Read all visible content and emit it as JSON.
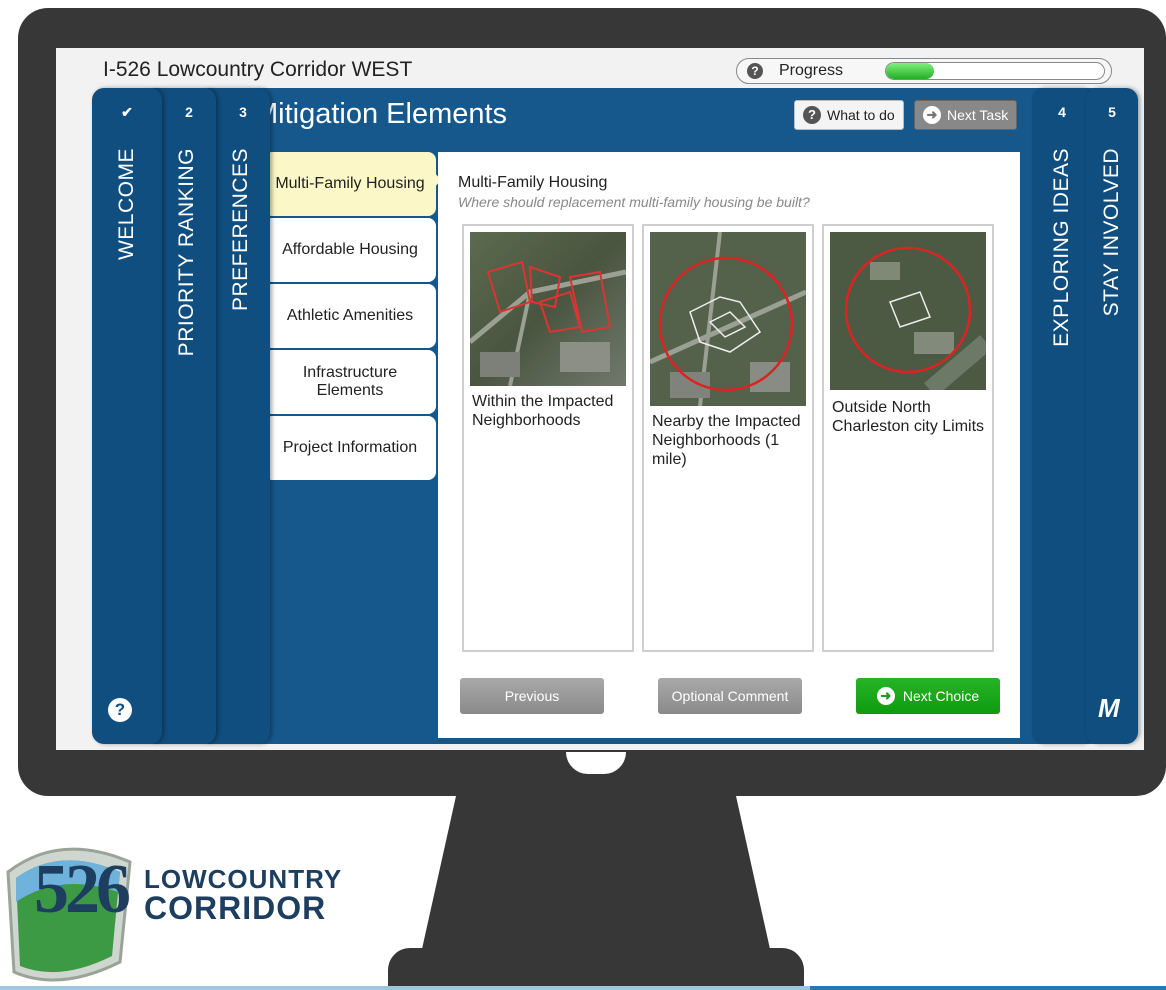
{
  "app": {
    "title": "I-526 Lowcountry Corridor WEST"
  },
  "progress": {
    "label": "Progress",
    "help_glyph": "?",
    "fraction": 0.22
  },
  "steps": [
    {
      "num": "✔",
      "label": "WELCOME"
    },
    {
      "num": "2",
      "label": "PRIORITY RANKING"
    },
    {
      "num": "3",
      "label": "PREFERENCES"
    },
    {
      "num": "4",
      "label": "EXPLORING IDEAS"
    },
    {
      "num": "5",
      "label": "STAY INVOLVED"
    }
  ],
  "help_glyph": "?",
  "header": {
    "title": "Mitigation Elements",
    "what_to_do": "What to do",
    "next_task": "Next Task",
    "help_glyph": "?",
    "arrow_glyph": "➜"
  },
  "choices": [
    {
      "label": "Multi-Family Housing",
      "active": true
    },
    {
      "label": "Affordable Housing"
    },
    {
      "label": "Athletic Amenities"
    },
    {
      "label": "Infrastructure Elements"
    },
    {
      "label": "Project Information"
    }
  ],
  "content": {
    "title": "Multi-Family Housing",
    "question": "Where should replacement multi-family housing be built?",
    "options": [
      {
        "label": "Within the Impacted Neighborhoods",
        "icon": "aerial-map-neighborhoods"
      },
      {
        "label": "Nearby the Impacted Neighborhoods (1 mile)",
        "icon": "aerial-map-1-mile-radius"
      },
      {
        "label": "Outside North Charleston city Limits",
        "icon": "aerial-map-outside-city"
      }
    ]
  },
  "footer": {
    "previous": "Previous",
    "optional_comment": "Optional Comment",
    "next_choice": "Next Choice",
    "arrow_glyph": "➜"
  },
  "brand": {
    "number": "526",
    "line1": "LOWCOUNTRY",
    "line2": "CORRIDOR"
  },
  "colors": {
    "primary": "#17588c",
    "accent_green": "#1aa81a",
    "active_choice": "#fcf7c6",
    "brand_navy": "#1d3e5e"
  }
}
